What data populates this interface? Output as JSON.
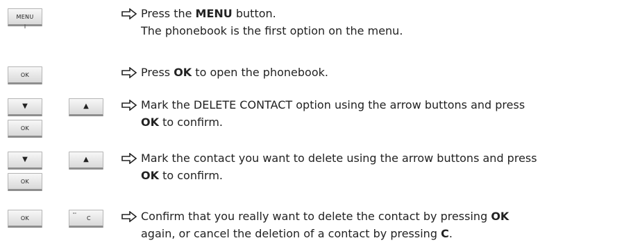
{
  "buttons": {
    "menu": "MENU",
    "ok": "OK",
    "down": "▼",
    "up": "▲",
    "c": "C",
    "voicemail_symbol": "ᵒᵒ"
  },
  "steps": [
    {
      "pre": "Press the ",
      "bold": "MENU",
      "post": " button.",
      "line2": "The phonebook is the first option on the menu."
    },
    {
      "pre": "Press ",
      "bold": "OK",
      "post": " to open the phonebook."
    },
    {
      "line1": "Mark the DELETE CONTACT option using the arrow buttons and press",
      "bold": "OK",
      "post": " to confirm."
    },
    {
      "line1": "Mark the contact you want to delete using the arrow buttons and press",
      "bold": "OK",
      "post": " to confirm."
    },
    {
      "line1_pre": "Confirm that you really want to delete the contact by pressing ",
      "line1_bold": "OK",
      "line2_pre": "again, or cancel the deletion of a contact by pressing ",
      "line2_bold": "C",
      "line2_post": "."
    }
  ]
}
